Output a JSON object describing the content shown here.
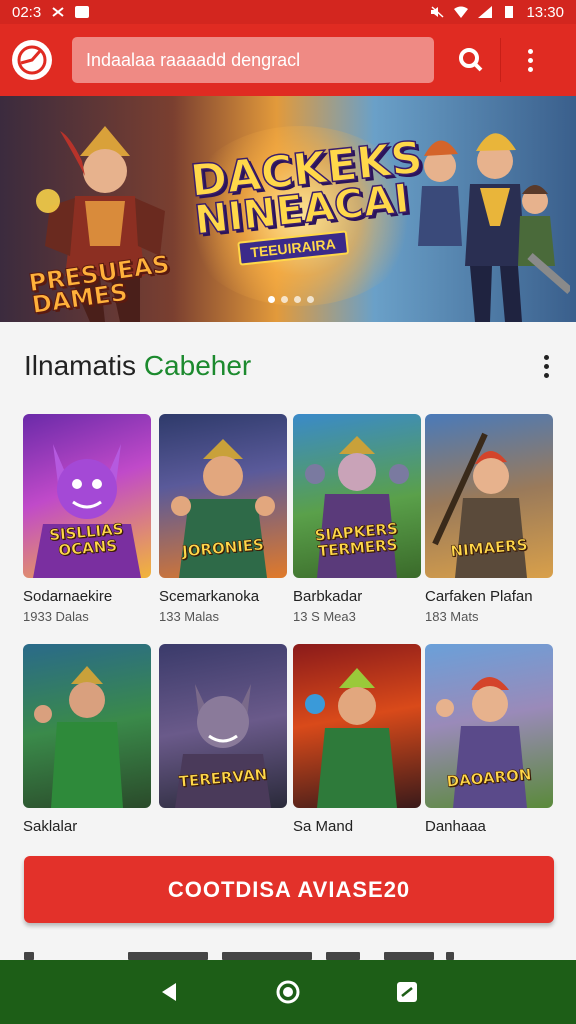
{
  "status_bar": {
    "time_left": "02:3",
    "time_right": "13:30"
  },
  "header": {
    "search_placeholder": "Indaalaa raaaadd dengracl",
    "icons": [
      "logo-icon",
      "search-icon",
      "more-vert-icon"
    ]
  },
  "banner": {
    "title_line1": "DACKEKS",
    "title_line2": "NINEACAI",
    "title_ribbon": "TEEUIRAIRA",
    "subtitle": "PRESUEAS DAMES",
    "slide_count": 4,
    "active_slide": 0
  },
  "section": {
    "title_main": "Ilnamatis",
    "title_accent": "Cabeher"
  },
  "games": [
    {
      "thumb_text": "SISLLIAS OCANS",
      "name": "Sodarnaekire",
      "meta": "1933 Dalas"
    },
    {
      "thumb_text": "JORONIES",
      "name": "Scemarkanoka",
      "meta": "133 Malas"
    },
    {
      "thumb_text": "SIAPKERS TERMERS",
      "name": "Barbkadar",
      "meta": "13 S Mea3"
    },
    {
      "thumb_text": "NIMAERS",
      "name": "Carfaken Plafan",
      "meta": "183 Mats"
    },
    {
      "thumb_text": "",
      "name": "Saklalar",
      "meta": ""
    },
    {
      "thumb_text": "TERERVAN",
      "name": "",
      "meta": ""
    },
    {
      "thumb_text": "",
      "name": "Sa Mand",
      "meta": ""
    },
    {
      "thumb_text": "DAOARON",
      "name": "Danhaaa",
      "meta": ""
    }
  ],
  "cta": {
    "label": "COOTDISA AVIASE20"
  },
  "colors": {
    "brand_red": "#e02b22",
    "accent_green": "#1c8a2e",
    "nav_green": "#1d5e17"
  }
}
